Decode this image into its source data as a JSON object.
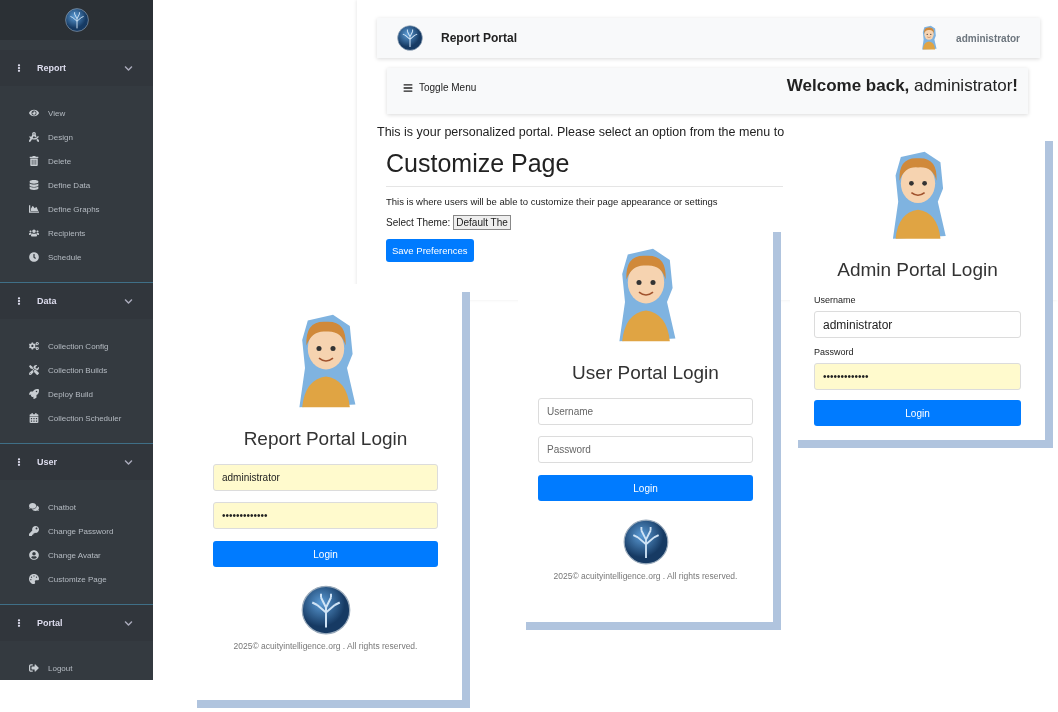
{
  "sidebar": {
    "sections": [
      {
        "title": "Report",
        "expanded": true,
        "items": [
          {
            "label": "View"
          },
          {
            "label": "Design"
          },
          {
            "label": "Delete"
          },
          {
            "label": "Define Data"
          },
          {
            "label": "Define Graphs"
          },
          {
            "label": "Recipients"
          },
          {
            "label": "Schedule"
          }
        ]
      },
      {
        "title": "Data",
        "expanded": true,
        "items": [
          {
            "label": "Collection Config"
          },
          {
            "label": "Collection Builds"
          },
          {
            "label": "Deploy Build"
          },
          {
            "label": "Collection Scheduler"
          }
        ]
      },
      {
        "title": "User",
        "expanded": true,
        "items": [
          {
            "label": "Chatbot"
          },
          {
            "label": "Change Password"
          },
          {
            "label": "Change Avatar"
          },
          {
            "label": "Customize Page"
          }
        ]
      },
      {
        "title": "Portal",
        "expanded": true,
        "items": [
          {
            "label": "Logout"
          }
        ]
      }
    ]
  },
  "portal": {
    "header": {
      "title": "Report Portal",
      "user": "administrator"
    },
    "toggle_label": "Toggle Menu",
    "welcome": "**Welcome back,** administrator**!**",
    "intro": "This is your personalized portal. Please select an option from the menu to",
    "customize": {
      "heading": "Customize Page",
      "description": "This is where users will be able to customize their page appearance or settings",
      "theme_label": "Select Theme:",
      "theme_value": "Default The",
      "button": "Save Preferences"
    }
  },
  "login_cards": [
    {
      "title": "Report Portal Login",
      "fields": [
        {
          "kind": "text",
          "value": "administrator",
          "autofilled": true
        },
        {
          "kind": "password",
          "value": "•••••••••••••",
          "autofilled": true
        }
      ],
      "button": "Login",
      "footer": "2025© acuityintelligence.org . All rights reserved."
    },
    {
      "title": "User Portal Login",
      "fields": [
        {
          "kind": "text",
          "placeholder": "Username",
          "autofilled": false
        },
        {
          "kind": "password",
          "placeholder": "Password",
          "autofilled": false
        }
      ],
      "button": "Login",
      "footer": "2025© acuityintelligence.org . All rights reserved."
    },
    {
      "title": "Admin Portal Login",
      "fields": [
        {
          "kind": "text",
          "label": "Username",
          "value": "administrator",
          "autofilled": false
        },
        {
          "kind": "password",
          "label": "Password",
          "value": "•••••••••••••",
          "autofilled": true
        }
      ],
      "button": "Login"
    }
  ]
}
